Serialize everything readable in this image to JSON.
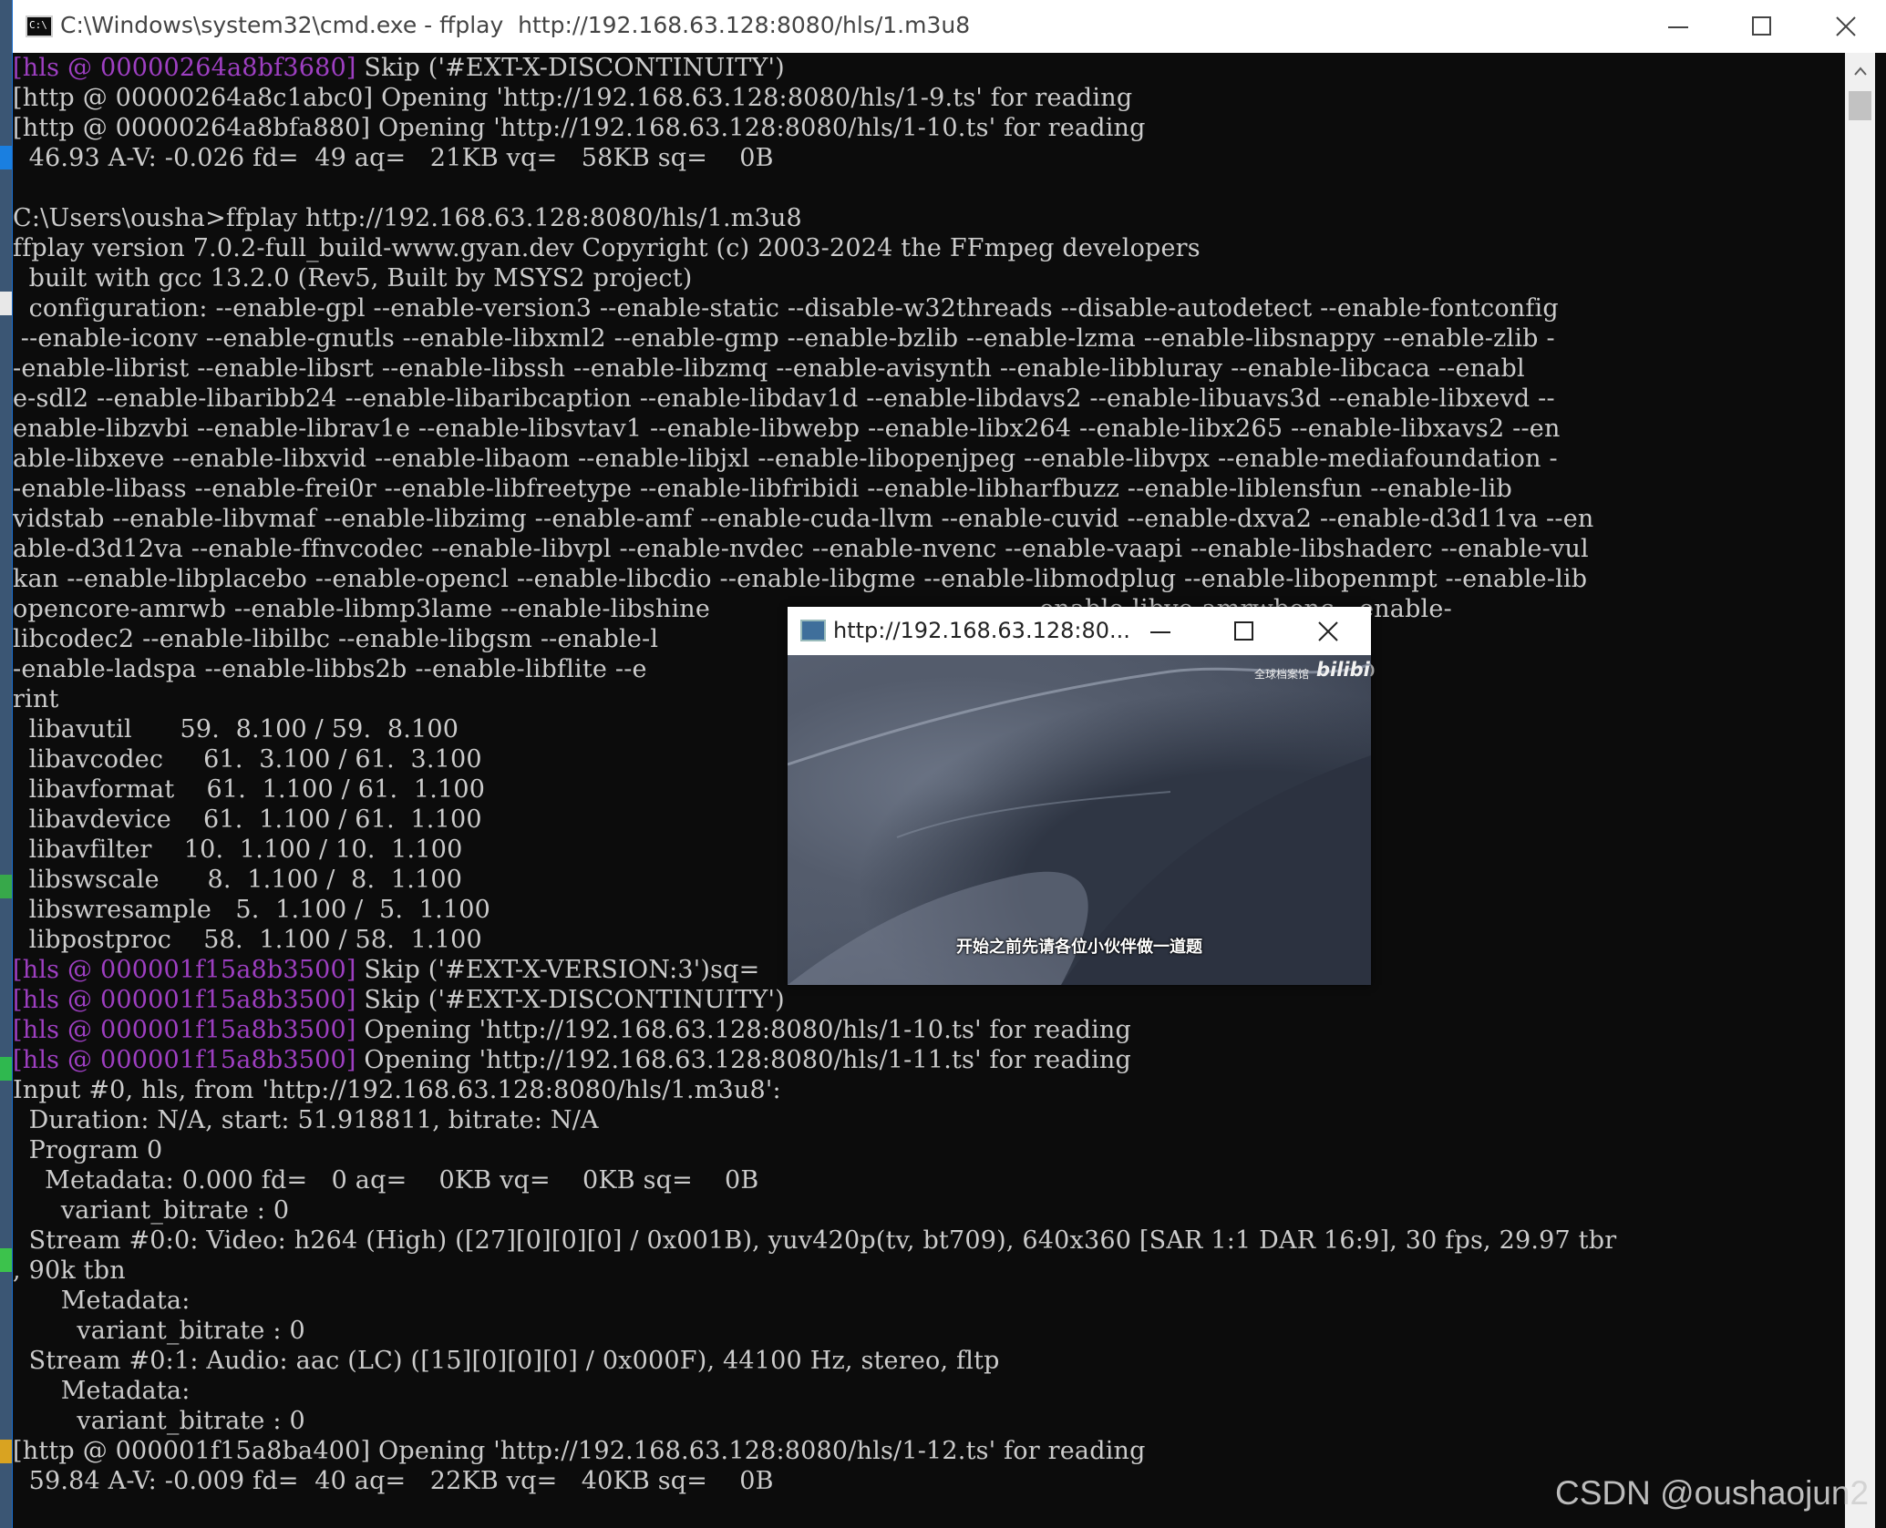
{
  "cmd_window": {
    "title": "C:\\Windows\\system32\\cmd.exe - ffplay  http://192.168.63.128:8080/hls/1.m3u8",
    "icon_label": "C:\\"
  },
  "console_lines": [
    {
      "tag": "[hls @ 00000264a8bf3680]",
      "text": " Skip ('#EXT-X-DISCONTINUITY')"
    },
    {
      "tag": "",
      "text": "[http @ 00000264a8c1abc0] Opening 'http://192.168.63.128:8080/hls/1-9.ts' for reading"
    },
    {
      "tag": "",
      "text": "[http @ 00000264a8bfa880] Opening 'http://192.168.63.128:8080/hls/1-10.ts' for reading"
    },
    {
      "tag": "",
      "text": "  46.93 A-V: -0.026 fd=  49 aq=   21KB vq=   58KB sq=    0B"
    },
    {
      "tag": "",
      "text": ""
    },
    {
      "tag": "",
      "text": "C:\\Users\\ousha>ffplay http://192.168.63.128:8080/hls/1.m3u8"
    },
    {
      "tag": "",
      "text": "ffplay version 7.0.2-full_build-www.gyan.dev Copyright (c) 2003-2024 the FFmpeg developers"
    },
    {
      "tag": "",
      "text": "  built with gcc 13.2.0 (Rev5, Built by MSYS2 project)"
    },
    {
      "tag": "",
      "text": "  configuration: --enable-gpl --enable-version3 --enable-static --disable-w32threads --disable-autodetect --enable-fontconfig"
    },
    {
      "tag": "",
      "text": " --enable-iconv --enable-gnutls --enable-libxml2 --enable-gmp --enable-bzlib --enable-lzma --enable-libsnappy --enable-zlib -"
    },
    {
      "tag": "",
      "text": "-enable-librist --enable-libsrt --enable-libssh --enable-libzmq --enable-avisynth --enable-libbluray --enable-libcaca --enabl"
    },
    {
      "tag": "",
      "text": "e-sdl2 --enable-libaribb24 --enable-libaribcaption --enable-libdav1d --enable-libdavs2 --enable-libuavs3d --enable-libxevd --"
    },
    {
      "tag": "",
      "text": "enable-libzvbi --enable-librav1e --enable-libsvtav1 --enable-libwebp --enable-libx264 --enable-libx265 --enable-libxavs2 --en"
    },
    {
      "tag": "",
      "text": "able-libxeve --enable-libxvid --enable-libaom --enable-libjxl --enable-libopenjpeg --enable-libvpx --enable-mediafoundation -"
    },
    {
      "tag": "",
      "text": "-enable-libass --enable-frei0r --enable-libfreetype --enable-libfribidi --enable-libharfbuzz --enable-liblensfun --enable-lib"
    },
    {
      "tag": "",
      "text": "vidstab --enable-libvmaf --enable-libzimg --enable-amf --enable-cuda-llvm --enable-cuvid --enable-dxva2 --enable-d3d11va --en"
    },
    {
      "tag": "",
      "text": "able-d3d12va --enable-ffnvcodec --enable-libvpl --enable-nvdec --enable-nvenc --enable-vaapi --enable-libshaderc --enable-vul"
    },
    {
      "tag": "",
      "text": "kan --enable-libplacebo --enable-opencl --enable-libcdio --enable-libgme --enable-libmodplug --enable-libopenmpt --enable-lib"
    },
    {
      "tag": "",
      "text": "opencore-amrwb --enable-libmp3lame --enable-libshine                                       --enable-libvo-amrwbenc --enable-"
    },
    {
      "tag": "",
      "text": "libcodec2 --enable-libilbc --enable-libgsm --enable-l                                       le-libspeex --enable-libvorbis -"
    },
    {
      "tag": "",
      "text": "-enable-ladspa --enable-libbs2b --enable-libflite --e                                       -enable-libsoxr --enable-chromap"
    },
    {
      "tag": "",
      "text": "rint"
    },
    {
      "tag": "",
      "text": "  libavutil      59.  8.100 / 59.  8.100"
    },
    {
      "tag": "",
      "text": "  libavcodec     61.  3.100 / 61.  3.100"
    },
    {
      "tag": "",
      "text": "  libavformat    61.  1.100 / 61.  1.100"
    },
    {
      "tag": "",
      "text": "  libavdevice    61.  1.100 / 61.  1.100"
    },
    {
      "tag": "",
      "text": "  libavfilter    10.  1.100 / 10.  1.100"
    },
    {
      "tag": "",
      "text": "  libswscale      8.  1.100 /  8.  1.100"
    },
    {
      "tag": "",
      "text": "  libswresample   5.  1.100 /  5.  1.100"
    },
    {
      "tag": "",
      "text": "  libpostproc    58.  1.100 / 58.  1.100"
    },
    {
      "tag": "[hls @ 000001f15a8b3500]",
      "text": " Skip ('#EXT-X-VERSION:3')sq="
    },
    {
      "tag": "[hls @ 000001f15a8b3500]",
      "text": " Skip ('#EXT-X-DISCONTINUITY')"
    },
    {
      "tag": "[hls @ 000001f15a8b3500]",
      "text": " Opening 'http://192.168.63.128:8080/hls/1-10.ts' for reading"
    },
    {
      "tag": "[hls @ 000001f15a8b3500]",
      "text": " Opening 'http://192.168.63.128:8080/hls/1-11.ts' for reading"
    },
    {
      "tag": "",
      "text": "Input #0, hls, from 'http://192.168.63.128:8080/hls/1.m3u8':"
    },
    {
      "tag": "",
      "text": "  Duration: N/A, start: 51.918811, bitrate: N/A"
    },
    {
      "tag": "",
      "text": "  Program 0"
    },
    {
      "tag": "",
      "text": "    Metadata: 0.000 fd=   0 aq=    0KB vq=    0KB sq=    0B"
    },
    {
      "tag": "",
      "text": "      variant_bitrate : 0"
    },
    {
      "tag": "",
      "text": "  Stream #0:0: Video: h264 (High) ([27][0][0][0] / 0x001B), yuv420p(tv, bt709), 640x360 [SAR 1:1 DAR 16:9], 30 fps, 29.97 tbr"
    },
    {
      "tag": "",
      "text": ", 90k tbn"
    },
    {
      "tag": "",
      "text": "      Metadata:"
    },
    {
      "tag": "",
      "text": "        variant_bitrate : 0"
    },
    {
      "tag": "",
      "text": "  Stream #0:1: Audio: aac (LC) ([15][0][0][0] / 0x000F), 44100 Hz, stereo, fltp"
    },
    {
      "tag": "",
      "text": "      Metadata:"
    },
    {
      "tag": "",
      "text": "        variant_bitrate : 0"
    },
    {
      "tag": "",
      "text": "[http @ 000001f15a8ba400] Opening 'http://192.168.63.128:8080/hls/1-12.ts' for reading"
    },
    {
      "tag": "",
      "text": "  59.84 A-V: -0.009 fd=  40 aq=   22KB vq=   40KB sq=    0B"
    }
  ],
  "ffplay_window": {
    "title": "http://192.168.63.128:80...",
    "watermark_text": "全球档案馆",
    "watermark_logo": "bilibili",
    "subtitle": "开始之前先请各位小伙伴做一道题"
  },
  "page_watermark": "CSDN @oushaojun2",
  "colors": {
    "console_bg": "#0c0c0c",
    "console_text": "#cccccc",
    "log_tag_magenta": "#9e3fc2",
    "titlebar_bg": "#ffffff",
    "scrollbar_bg": "#f0f0f0"
  }
}
